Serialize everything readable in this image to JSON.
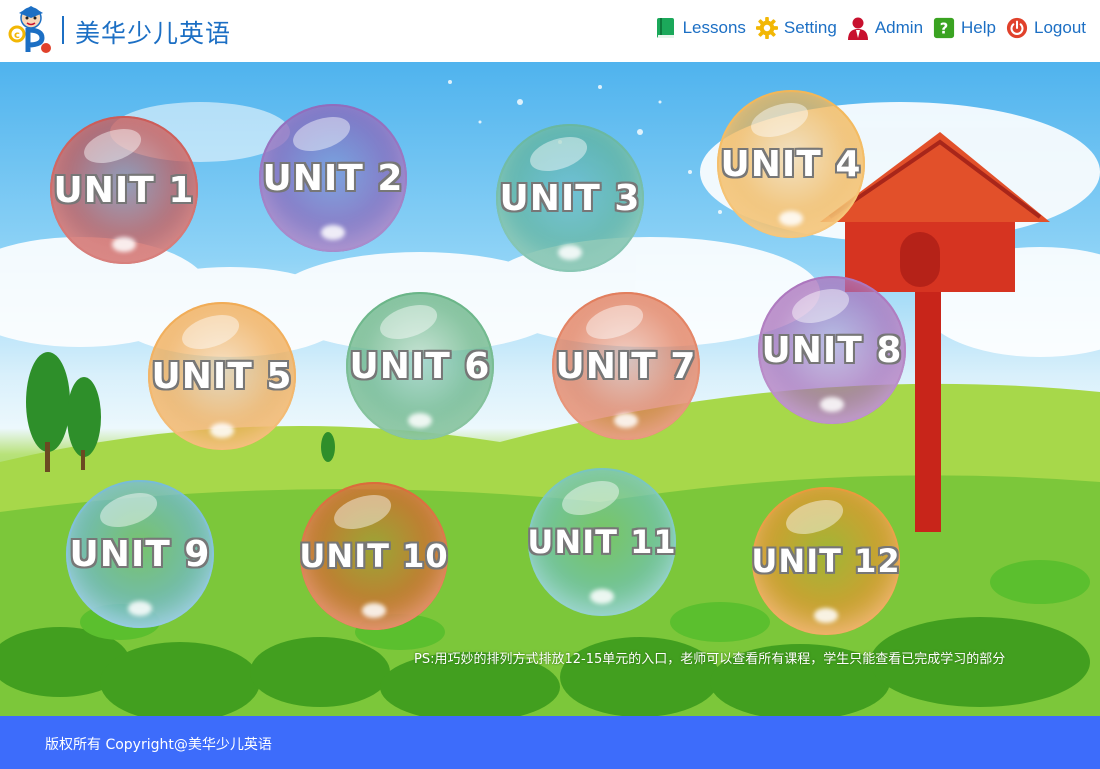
{
  "header": {
    "brand": "美华少儿英语",
    "logo_icon": "cartoon-teacher-logo-icon",
    "nav": [
      {
        "label": "Lessons",
        "icon": "book-icon",
        "color": "#1ba85a"
      },
      {
        "label": "Setting",
        "icon": "gear-icon",
        "color": "#f2b705"
      },
      {
        "label": "Admin",
        "icon": "user-icon",
        "color": "#c8102e"
      },
      {
        "label": "Help",
        "icon": "help-icon",
        "color": "#3aa321"
      },
      {
        "label": "Logout",
        "icon": "power-icon",
        "color": "#e0412b"
      }
    ]
  },
  "units": [
    {
      "label": "UNIT 1",
      "color": "#c9504c"
    },
    {
      "label": "UNIT 2",
      "color": "#8a62b8"
    },
    {
      "label": "UNIT 3",
      "color": "#5fb39a"
    },
    {
      "label": "UNIT 4",
      "color": "#f2b24d"
    },
    {
      "label": "UNIT 5",
      "color": "#f0a64a"
    },
    {
      "label": "UNIT 6",
      "color": "#5fb07f"
    },
    {
      "label": "UNIT 7",
      "color": "#e07552"
    },
    {
      "label": "UNIT 8",
      "color": "#a66cb9"
    },
    {
      "label": "UNIT 9",
      "color": "#6fb8d3"
    },
    {
      "label": "UNIT 10",
      "color": "#d9622e"
    },
    {
      "label": "UNIT 11",
      "color": "#6fc2b9"
    },
    {
      "label": "UNIT 12",
      "color": "#e8932e"
    }
  ],
  "note": "PS:用巧妙的排列方式排放12-15单元的入口，老师可以查看所有课程，学生只能查看已完成学习的部分",
  "footer": {
    "copyright": "版权所有 Copyright@美华少儿英语",
    "background": "#3d6cfb"
  }
}
